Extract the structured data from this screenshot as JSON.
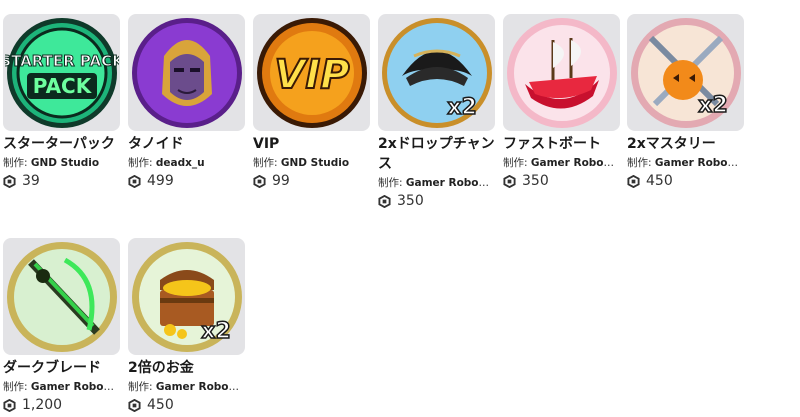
{
  "creator_prefix": "制作:",
  "items": [
    {
      "name": "スターターパック",
      "creator": "GND Studio",
      "price": "39",
      "art": "starter-pack",
      "art_text": "STARTER PACK"
    },
    {
      "name": "タノイド",
      "creator": "deadx_u",
      "price": "499",
      "art": "thanos"
    },
    {
      "name": "VIP",
      "creator": "GND Studio",
      "price": "99",
      "art": "vip",
      "art_text": "VIP"
    },
    {
      "name": "2xドロップチャンス",
      "creator": "Gamer Robot I...",
      "price": "350",
      "art": "hat-x2",
      "art_text": "x2"
    },
    {
      "name": "ファストボート",
      "creator": "Gamer Robot I...",
      "price": "350",
      "art": "boat"
    },
    {
      "name": "2xマスタリー",
      "creator": "Gamer Robot I...",
      "price": "450",
      "art": "swords-x2",
      "art_text": "x2"
    },
    {
      "name": "ダークブレード",
      "creator": "Gamer Robot I...",
      "price": "1,200",
      "art": "green-blade"
    },
    {
      "name": "2倍のお金",
      "creator": "Gamer Robot I...",
      "price": "450",
      "art": "treasure-x2",
      "art_text": "x2"
    }
  ]
}
